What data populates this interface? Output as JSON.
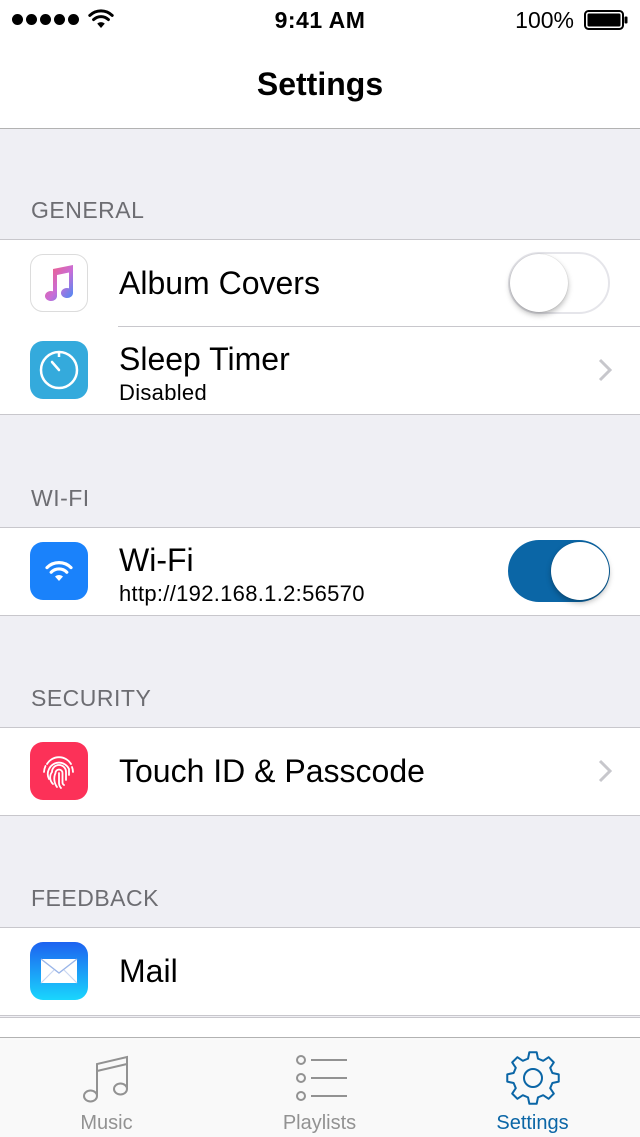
{
  "status_bar": {
    "time": "9:41 AM",
    "battery": "100%",
    "signal_icon": "signal-dots-icon",
    "wifi_icon": "wifi-icon",
    "battery_icon": "battery-full-icon"
  },
  "nav": {
    "title": "Settings"
  },
  "sections": {
    "general": {
      "header": "GENERAL",
      "album_covers": {
        "title": "Album Covers",
        "icon": "music-note-icon",
        "toggle_on": false
      },
      "sleep_timer": {
        "title": "Sleep Timer",
        "subtitle": "Disabled",
        "icon": "timer-icon"
      }
    },
    "wifi": {
      "header": "WI-FI",
      "wifi": {
        "title": "Wi-Fi",
        "subtitle": "http://192.168.1.2:56570",
        "icon": "wifi-icon",
        "toggle_on": true
      }
    },
    "security": {
      "header": "SECURITY",
      "touch_id": {
        "title": "Touch ID & Passcode",
        "icon": "fingerprint-icon"
      }
    },
    "feedback": {
      "header": "FEEDBACK",
      "mail": {
        "title": "Mail",
        "icon": "mail-envelope-icon"
      }
    }
  },
  "tabbar": {
    "music": {
      "label": "Music",
      "icon": "music-note-icon"
    },
    "playlists": {
      "label": "Playlists",
      "icon": "list-icon"
    },
    "settings": {
      "label": "Settings",
      "icon": "gear-icon",
      "active": true
    }
  },
  "colors": {
    "accent": "#0b66a6",
    "background": "#efeff4",
    "section_header": "#6d6d72",
    "separator": "#c8c7cc",
    "tab_inactive": "#929292"
  }
}
